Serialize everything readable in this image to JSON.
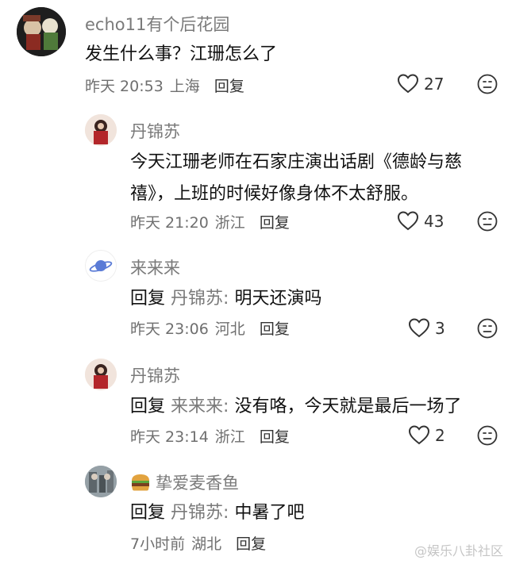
{
  "comments": [
    {
      "username": "echo11有个后花园",
      "text": "发生什么事？江珊怎么了",
      "time": "昨天 20:53",
      "location": "上海",
      "reply_label": "回复",
      "likes": "27"
    },
    {
      "username": "丹锦苏",
      "text_line1": "今天江珊老师在石家庄演出话剧《德龄与慈",
      "text_line2": "禧》，上班的时候好像身体不太舒服。",
      "time": "昨天 21:20",
      "location": "浙江",
      "reply_label": "回复",
      "likes": "43"
    },
    {
      "username": "来来来",
      "reply_prefix": "回复",
      "reply_target": "丹锦苏:",
      "text": "明天还演吗",
      "time": "昨天 23:06",
      "location": "河北",
      "reply_label": "回复",
      "likes": "3"
    },
    {
      "username": "丹锦苏",
      "reply_prefix": "回复",
      "reply_target": "来来来:",
      "text": "没有咯，今天就是最后一场了",
      "time": "昨天 23:14",
      "location": "浙江",
      "reply_label": "回复",
      "likes": "2"
    },
    {
      "username": "挚爱麦香鱼",
      "reply_prefix": "回复",
      "reply_target": "丹锦苏:",
      "text": "中暑了吧",
      "time": "7小时前",
      "location": "湖北",
      "reply_label": "回复"
    }
  ],
  "watermark": "@娱乐八卦社区",
  "icons": {
    "like": "heart-outline-icon",
    "dislike": "frown-face-icon",
    "badge": "burger-emoji-icon"
  }
}
